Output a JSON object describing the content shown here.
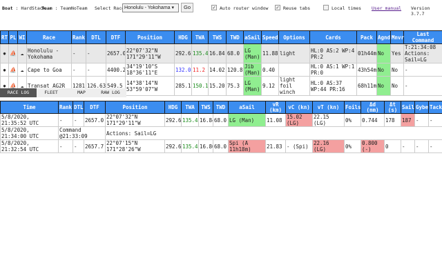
{
  "header": {
    "boat_label": "Boat",
    "boat_name": "HardStack",
    "team_label": "Team",
    "team_name": "TeamNoTeam",
    "select_label": "Select Race",
    "selected_race": "Honolulu - Yokohama",
    "go_label": "Go",
    "auto_router_label": "Auto router window",
    "auto_router_checked": true,
    "reuse_tabs_label": "Reuse tabs",
    "reuse_tabs_checked": true,
    "local_times_label": "Local times",
    "local_times_checked": false,
    "user_manual_label": "User manual",
    "version": "Version 3.7.7"
  },
  "races_table": {
    "columns": [
      "RT",
      "PL",
      "WI",
      "Race",
      "Rank",
      "DTL",
      "DTF",
      "Position",
      "HDG",
      "TWA",
      "TWS",
      "TWD",
      "aSail",
      "Speed",
      "Options",
      "Cards",
      "Pack",
      "Agnd",
      "Mnvr",
      "Last Command"
    ],
    "rows": [
      {
        "race": "Honolulu - Yokohama",
        "rank": "-",
        "dtl": "-",
        "dtf": "2657.0",
        "position": [
          "22°07'32\"N",
          "171°29'11\"W"
        ],
        "hdg": "292.6",
        "twa": "135.4",
        "twa_color": "green",
        "tws": "16.84",
        "twd": "68.0",
        "asail": "LG (Man)",
        "speed": "11.88",
        "options": "light",
        "cards": "HL:0 AS:2 WP:4 PR:2",
        "pack": "01h44m",
        "agnd": "No",
        "mnvr": "Yes",
        "last_command": "T:21:34:08 Actions: Sail=LG"
      },
      {
        "race": "Cape to Goa",
        "rank": "-",
        "dtl": "-",
        "dtf": "4400.2",
        "position": [
          "34°19'10\"S",
          "18°36'11\"E"
        ],
        "hdg": "132.0",
        "hdg_color": "blue",
        "twa": "11.2",
        "twa_color": "red",
        "tws": "14.02",
        "twd": "120.8",
        "asail": "Jib (Man)",
        "speed": "0.40",
        "options": "",
        "cards": "HL:0 AS:1 WP:1 PR:0",
        "pack": "43h54m",
        "agnd": "No",
        "mnvr": "No",
        "last_command": "-"
      },
      {
        "race": "Transat AG2R",
        "rank": "1281",
        "dtl": "126.63",
        "dtf": "549.5",
        "position": [
          "14°38'14\"N",
          "53°59'07\"W"
        ],
        "hdg": "285.1",
        "twa": "150.1",
        "twa_color": "green",
        "tws": "15.20",
        "twd": "75.3",
        "asail": "LG (Man)",
        "speed": "9.12",
        "options": "light foil winch",
        "cards": "HL:0 AS:37 WP:44 PR:16",
        "pack": "68h11m",
        "agnd": "No",
        "mnvr": "No",
        "last_command": "-"
      }
    ]
  },
  "tabs": [
    {
      "label": "RACE LOG",
      "active": true
    },
    {
      "label": "FLEET"
    },
    {
      "label": "MAP"
    },
    {
      "label": "RAW LOG"
    }
  ],
  "log_table": {
    "columns": [
      "Time",
      "Rank",
      "DTL",
      "DTF",
      "Position",
      "HDG",
      "TWA",
      "TWS",
      "TWD",
      "aSail",
      "vR (km)",
      "vC (kn)",
      "vT (kn)",
      "Foils",
      "Δd (nm)",
      "Δt (s)",
      "Sail",
      "Gybe",
      "Tack"
    ],
    "rows": [
      {
        "type": "data",
        "time": "5/8/2020, 21:35:52 UTC",
        "rank": "-",
        "dtl": "-",
        "dtf": "2657.0",
        "position": "22°07'32\"N 171°29'11\"W",
        "hdg": "292.6",
        "twa": "135.4",
        "tws": "16.84",
        "twd": "68.0",
        "asail": "LG (Man)",
        "vr": "11.08",
        "vc": "15.02 (LG)",
        "vt": "22.15 (LG)",
        "foils": "0%",
        "dd": "0.744",
        "dt": "178",
        "sail": "187",
        "gybe": "-",
        "tack": "-"
      },
      {
        "type": "command",
        "time": "5/8/2020, 21:34:00 UTC",
        "command": "Command @21:33:09",
        "actions": "Actions: Sail=LG"
      },
      {
        "type": "data",
        "time": "5/8/2020, 21:32:54 UTC",
        "rank": "-",
        "dtl": "-",
        "dtf": "2657.7",
        "position": "22°07'15\"N 171°28'26\"W",
        "hdg": "292.6",
        "twa": "135.4",
        "tws": "16.86",
        "twd": "68.0",
        "asail": "Spi (A 11h18m)",
        "vr": "21.83",
        "vc": "- (Spi)",
        "vt": "22.16 (LG)",
        "foils": "0%",
        "dd": "0.800 (-)",
        "dt": "0",
        "sail": "-",
        "gybe": "-",
        "tack": "-"
      }
    ]
  },
  "colors": {
    "header_blue": "#3b8df0",
    "green": "#90ee90",
    "pink": "#f4a0a0"
  }
}
